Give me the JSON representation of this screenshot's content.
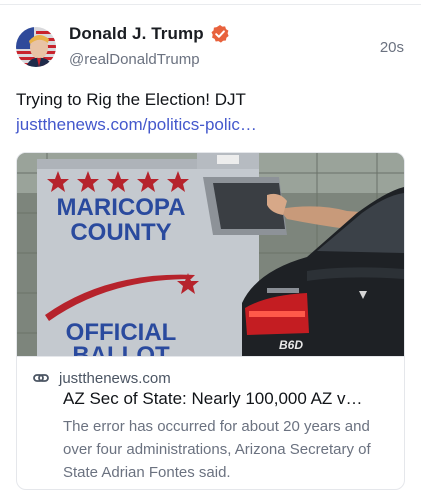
{
  "post": {
    "display_name": "Donald J. Trump",
    "handle": "@realDonaldTrump",
    "timestamp": "20s",
    "text": "Trying to Rig the Election! DJT",
    "link_text": "justthenews.com/politics-polic…",
    "avatar_icon": "flag-portrait-avatar",
    "verified_icon": "verified-badge-icon",
    "verified_color": "#e8623d",
    "link_color": "#4458cc"
  },
  "card": {
    "image_sign_line1": "MARICOPA",
    "image_sign_line2": "COUNTY",
    "image_sign_line3": "OFFICIAL",
    "image_sign_line4": "BALLOT",
    "image_car_badge": "B6D",
    "link_icon": "chain-link-icon",
    "domain": "justthenews.com",
    "title": "AZ Sec of State: Nearly 100,000 AZ v…",
    "description": "The error has occurred for about 20 years and over four administrations, Arizona Secretary of State Adrian Fontes said."
  }
}
